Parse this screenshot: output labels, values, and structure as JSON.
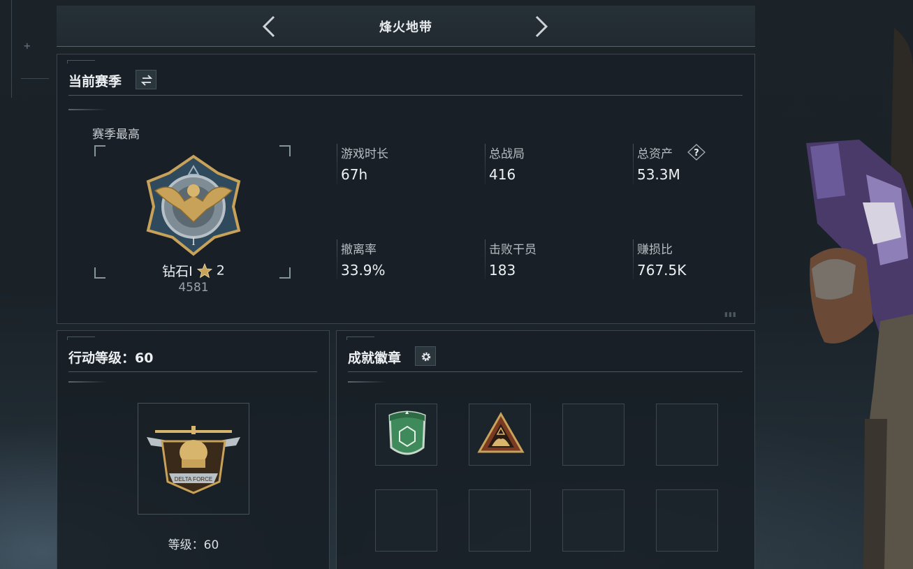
{
  "header": {
    "title": "烽火地带"
  },
  "season": {
    "title": "当前赛季",
    "peak_label": "赛季最高",
    "rank_name": "钻石I",
    "rank_stars": "2",
    "rank_score": "4581",
    "stats": [
      {
        "label": "游戏时长",
        "value": "67h"
      },
      {
        "label": "总战局",
        "value": "416"
      },
      {
        "label": "总资产",
        "value": "53.3M"
      },
      {
        "label": "撤离率",
        "value": "33.9%"
      },
      {
        "label": "击败干员",
        "value": "183"
      },
      {
        "label": "赚损比",
        "value": "767.5K"
      }
    ]
  },
  "level": {
    "title": "行动等级：60",
    "level_text": "等级：60",
    "emblem_text": "DELTA FORCE"
  },
  "achievements": {
    "title": "成就徽章",
    "slots": [
      {
        "filled": true,
        "icon": "green-shield-badge-icon"
      },
      {
        "filled": true,
        "icon": "triangle-hands-badge-icon"
      },
      {
        "filled": false
      },
      {
        "filled": false
      },
      {
        "filled": false
      },
      {
        "filled": false
      },
      {
        "filled": false
      },
      {
        "filled": false
      }
    ]
  },
  "colors": {
    "background": "#1a2228",
    "panel": "#181f25",
    "accent_gold": "#c9a25a",
    "badge_green": "#3f8a5a"
  },
  "icons": {
    "prev": "chevron-left-icon",
    "next": "chevron-right-icon",
    "switch": "swap-arrows-icon",
    "settings": "gear-icon",
    "help": "question-icon",
    "star": "star-icon"
  }
}
